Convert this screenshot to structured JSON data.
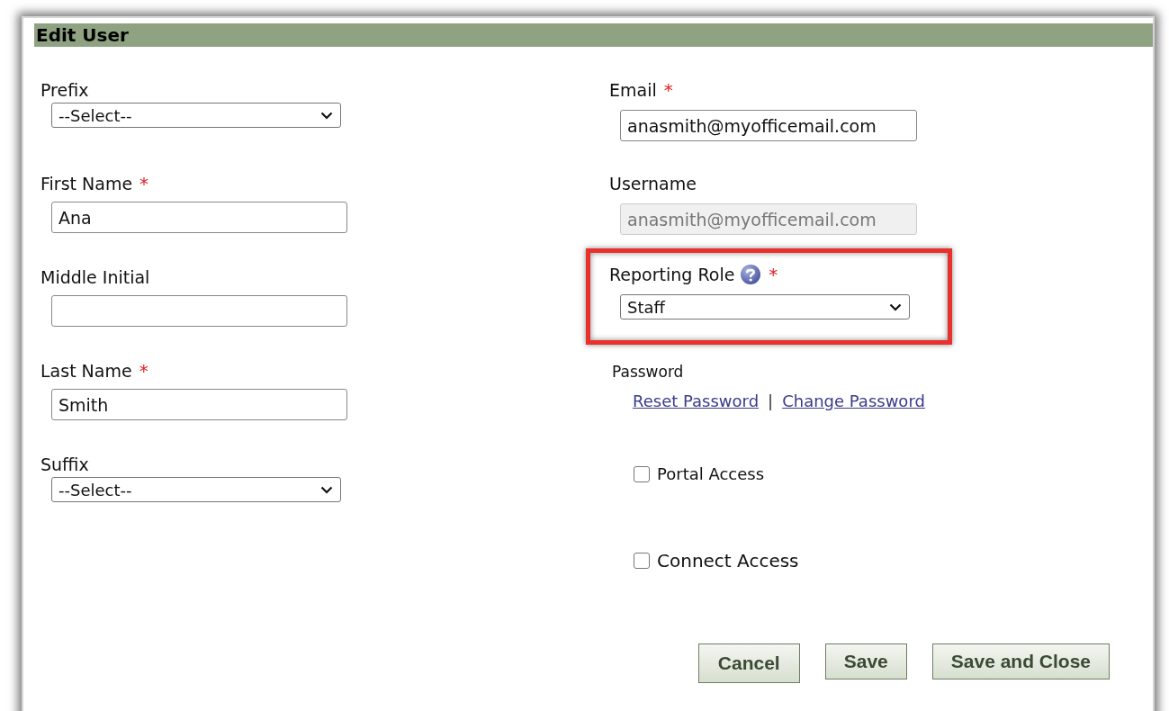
{
  "title": "Edit User",
  "left_fields": [
    {
      "kind": "select",
      "label": "Prefix",
      "value": "--Select--"
    },
    {
      "kind": "input",
      "label": "First Name",
      "required_mark": "*",
      "value": "Ana"
    },
    {
      "kind": "input",
      "label": "Middle Initial"
    },
    {
      "kind": "input",
      "label": "Last Name",
      "required_mark": "*",
      "value": "Smith"
    },
    {
      "kind": "select",
      "label": "Suffix",
      "value": "--Select--"
    }
  ],
  "right_fields": [
    {
      "label": "Email",
      "required_mark": "*",
      "value": "anasmith@myofficemail.com",
      "disabled": false
    },
    {
      "label": "Username",
      "value": "anasmith@myofficemail.com",
      "disabled": true
    }
  ],
  "reporting_role": {
    "label": "Reporting Role",
    "required_mark": "*",
    "value": "Staff",
    "highlighted": true
  },
  "password": {
    "label": "Password",
    "links": [
      "Reset Password",
      "Change Password"
    ],
    "separator": "|"
  },
  "checkboxes": [
    {
      "label": "Portal Access",
      "checked": false
    },
    {
      "label": "Connect Access",
      "checked": false
    }
  ],
  "buttons": [
    "Cancel",
    "Save",
    "Save and Close"
  ]
}
